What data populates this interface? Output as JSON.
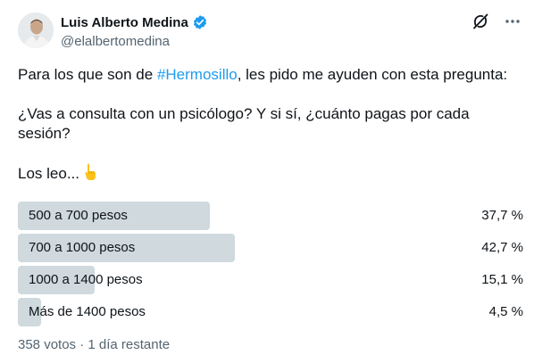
{
  "author": {
    "display_name": "Luis Alberto Medina",
    "handle": "@elalbertomedina",
    "verified_color": "#1d9bf0"
  },
  "tweet": {
    "line1_before": "Para los que son de ",
    "hashtag": "#Hermosillo",
    "line1_after": ", les pido me ayuden con esta pregunta:",
    "line2": "¿Vas a consulta con un psicólogo? Y si sí, ¿cuánto pagas por cada sesión?",
    "line3": "Los leo...",
    "emoji": "point-down-emoji"
  },
  "poll": {
    "options": [
      {
        "label": "500 a 700 pesos",
        "percent": "37,7 %",
        "value": 37.7
      },
      {
        "label": "700 a 1000 pesos",
        "percent": "42,7 %",
        "value": 42.7
      },
      {
        "label": "1000 a 1400 pesos",
        "percent": "15,1 %",
        "value": 15.1
      },
      {
        "label": "Más de 1400 pesos",
        "percent": "4,5 %",
        "value": 4.5
      }
    ],
    "votes": "358 votos",
    "separator": "·",
    "time_left": "1 día restante"
  },
  "icons": [
    "grok-icon",
    "more-icon",
    "verified-badge-icon"
  ],
  "colors": {
    "bar": "#cfd9de",
    "link": "#1d9bf0",
    "muted": "#536471"
  }
}
